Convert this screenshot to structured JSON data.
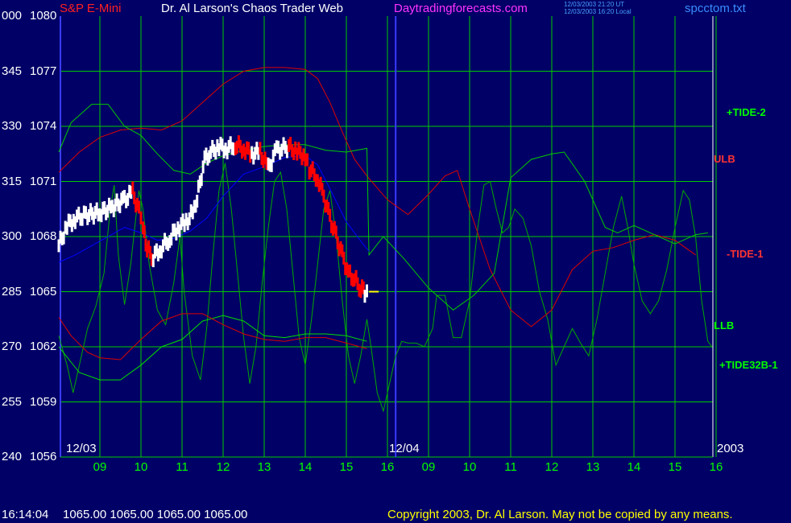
{
  "header": {
    "symbol": "S&P E-Mini",
    "title": "Dr. Al Larson's Chaos Trader Web",
    "site": "Daytradingforecasts.com",
    "ut_line": "12/03/2003 21:20 UT",
    "local_line": "12/03/2003 16:20 Local",
    "filename": "spcctom.txt"
  },
  "footer": {
    "time": "16:14:04",
    "ohlc": "1065.00 1065.00 1065.00 1065.00",
    "copyright": "Copyright 2003, Dr. Al Larson. May not be copied by any means."
  },
  "colors": {
    "background": "#000066",
    "grid": "#00cc00",
    "price_bar_up": "#ffffff",
    "price_bar_down": "#ff0000",
    "ulb": "#dd0000",
    "llb": "#00dd00",
    "tide2": "#00cc00",
    "tide1": "#dd0000",
    "tide32": "#00aa00",
    "average": "#0000ff",
    "date_divider": "#3a3aff"
  },
  "chart_data": {
    "type": "line",
    "title": "S&P E-Mini",
    "y_left_angle_labels": [
      "000",
      "345",
      "330",
      "315",
      "300",
      "285",
      "270",
      "255",
      "240"
    ],
    "y_right_price_labels": [
      "1080",
      "1077",
      "1074",
      "1071",
      "1068",
      "1065",
      "1062",
      "1059",
      "1056"
    ],
    "ylim": [
      1056,
      1080
    ],
    "grid": true,
    "x_hour_ticks": [
      "09",
      "10",
      "11",
      "12",
      "13",
      "14",
      "15",
      "16",
      "09",
      "10",
      "11",
      "12",
      "13",
      "14",
      "15",
      "16"
    ],
    "date_labels": [
      "12/03",
      "12/04",
      "2003"
    ],
    "series_labels": [
      {
        "name": "+TIDE-2",
        "color": "#00ff00"
      },
      {
        "name": "ULB",
        "color": "#ff3333"
      },
      {
        "name": "-TIDE-1",
        "color": "#ff3333"
      },
      {
        "name": "LLB",
        "color": "#00ff00"
      },
      {
        "name": "+TIDE32B-1",
        "color": "#00ff00"
      }
    ],
    "price_path": [
      [
        0.0,
        1067.5
      ],
      [
        0.2,
        1068.6
      ],
      [
        0.4,
        1069.0
      ],
      [
        0.7,
        1069.2
      ],
      [
        1.0,
        1069.3
      ],
      [
        1.3,
        1069.6
      ],
      [
        1.6,
        1070.0
      ],
      [
        1.8,
        1070.4
      ],
      [
        1.95,
        1069.4
      ],
      [
        2.05,
        1068.4
      ],
      [
        2.15,
        1067.3
      ],
      [
        2.3,
        1066.9
      ],
      [
        2.5,
        1067.4
      ],
      [
        2.7,
        1067.9
      ],
      [
        2.9,
        1068.5
      ],
      [
        3.1,
        1068.8
      ],
      [
        3.3,
        1069.4
      ],
      [
        3.4,
        1070.5
      ],
      [
        3.55,
        1072.2
      ],
      [
        3.7,
        1072.6
      ],
      [
        3.9,
        1072.9
      ],
      [
        4.1,
        1072.8
      ],
      [
        4.3,
        1073.0
      ],
      [
        4.5,
        1072.8
      ],
      [
        4.7,
        1072.5
      ],
      [
        4.9,
        1072.6
      ],
      [
        5.1,
        1071.7
      ],
      [
        5.3,
        1072.7
      ],
      [
        5.6,
        1072.9
      ],
      [
        5.8,
        1072.6
      ],
      [
        6.0,
        1072.4
      ],
      [
        6.1,
        1071.7
      ],
      [
        6.3,
        1071.2
      ],
      [
        6.45,
        1070.2
      ],
      [
        6.6,
        1069.0
      ],
      [
        6.75,
        1068.0
      ],
      [
        6.9,
        1067.0
      ],
      [
        7.05,
        1066.0
      ],
      [
        7.2,
        1065.7
      ],
      [
        7.35,
        1065.2
      ],
      [
        7.45,
        1065.0
      ],
      [
        7.55,
        1065.0
      ]
    ],
    "ulb_path": [
      [
        0.0,
        1071.5
      ],
      [
        0.5,
        1072.6
      ],
      [
        1.0,
        1073.4
      ],
      [
        1.5,
        1073.8
      ],
      [
        2.0,
        1073.9
      ],
      [
        2.5,
        1073.8
      ],
      [
        3.0,
        1074.3
      ],
      [
        3.5,
        1075.3
      ],
      [
        4.0,
        1076.3
      ],
      [
        4.5,
        1077.0
      ],
      [
        5.0,
        1077.2
      ],
      [
        5.5,
        1077.2
      ],
      [
        6.0,
        1077.1
      ],
      [
        6.3,
        1076.6
      ],
      [
        6.6,
        1075.3
      ],
      [
        6.9,
        1073.7
      ],
      [
        7.2,
        1072.2
      ],
      [
        7.5,
        1071.3
      ],
      [
        8.0,
        1070.0
      ],
      [
        8.5,
        1069.2
      ],
      [
        9.0,
        1070.3
      ],
      [
        9.4,
        1071.3
      ],
      [
        9.7,
        1071.6
      ],
      [
        10.0,
        1069.5
      ],
      [
        10.5,
        1066.2
      ],
      [
        11.0,
        1064.0
      ],
      [
        11.5,
        1063.1
      ],
      [
        12.0,
        1064.0
      ],
      [
        12.5,
        1066.2
      ],
      [
        13.0,
        1067.2
      ],
      [
        13.5,
        1067.4
      ],
      [
        14.0,
        1067.8
      ],
      [
        14.5,
        1068.1
      ],
      [
        15.0,
        1067.8
      ],
      [
        15.5,
        1067.0
      ]
    ],
    "llb_path": [
      [
        0.0,
        1062.0
      ],
      [
        0.5,
        1060.6
      ],
      [
        1.0,
        1060.2
      ],
      [
        1.5,
        1060.2
      ],
      [
        2.0,
        1061.0
      ],
      [
        2.5,
        1062.0
      ],
      [
        3.0,
        1062.4
      ],
      [
        3.5,
        1063.4
      ],
      [
        4.0,
        1063.7
      ],
      [
        4.5,
        1063.4
      ],
      [
        5.0,
        1062.6
      ],
      [
        5.5,
        1062.5
      ],
      [
        6.0,
        1062.7
      ],
      [
        6.5,
        1062.7
      ],
      [
        7.0,
        1062.6
      ],
      [
        7.5,
        1062.3
      ]
    ],
    "tide2_path": [
      [
        0.0,
        1072.6
      ],
      [
        0.3,
        1074.2
      ],
      [
        0.8,
        1075.2
      ],
      [
        1.2,
        1075.2
      ],
      [
        1.6,
        1074.0
      ],
      [
        2.0,
        1073.5
      ],
      [
        2.4,
        1072.5
      ],
      [
        2.8,
        1071.6
      ],
      [
        3.2,
        1071.4
      ],
      [
        3.6,
        1072.0
      ],
      [
        4.0,
        1072.4
      ],
      [
        4.5,
        1072.7
      ],
      [
        5.0,
        1072.9
      ],
      [
        5.5,
        1073.0
      ],
      [
        6.0,
        1073.0
      ],
      [
        6.5,
        1072.7
      ],
      [
        7.0,
        1072.6
      ],
      [
        7.5,
        1072.8
      ],
      [
        7.55,
        1067.0
      ],
      [
        7.9,
        1068.0
      ],
      [
        8.4,
        1066.8
      ],
      [
        9.0,
        1065.2
      ],
      [
        9.6,
        1064.0
      ],
      [
        10.1,
        1064.8
      ],
      [
        10.6,
        1066.0
      ],
      [
        11.0,
        1071.2
      ],
      [
        11.5,
        1072.2
      ],
      [
        12.0,
        1072.5
      ],
      [
        12.3,
        1072.6
      ],
      [
        12.8,
        1071.0
      ],
      [
        13.3,
        1068.5
      ],
      [
        13.6,
        1068.2
      ],
      [
        14.0,
        1068.6
      ],
      [
        14.5,
        1068.1
      ],
      [
        15.0,
        1067.6
      ],
      [
        15.5,
        1068.1
      ],
      [
        15.8,
        1068.2
      ]
    ],
    "tide1_path": [
      [
        0.0,
        1063.6
      ],
      [
        0.3,
        1062.6
      ],
      [
        0.7,
        1061.7
      ],
      [
        1.0,
        1061.4
      ],
      [
        1.5,
        1061.3
      ],
      [
        2.0,
        1062.4
      ],
      [
        2.5,
        1063.4
      ],
      [
        3.0,
        1063.8
      ],
      [
        3.5,
        1063.8
      ],
      [
        4.0,
        1063.2
      ],
      [
        4.5,
        1062.7
      ],
      [
        5.0,
        1062.4
      ],
      [
        5.5,
        1062.3
      ],
      [
        6.0,
        1062.5
      ],
      [
        6.5,
        1062.5
      ],
      [
        7.0,
        1062.2
      ],
      [
        7.5,
        1061.9
      ]
    ],
    "avg_path": [
      [
        0.0,
        1066.6
      ],
      [
        0.4,
        1067.0
      ],
      [
        0.8,
        1067.5
      ],
      [
        1.2,
        1068.0
      ],
      [
        1.6,
        1068.5
      ],
      [
        2.0,
        1068.2
      ],
      [
        2.4,
        1067.8
      ],
      [
        2.8,
        1067.9
      ],
      [
        3.2,
        1068.3
      ],
      [
        3.6,
        1069.0
      ],
      [
        4.0,
        1070.2
      ],
      [
        4.5,
        1071.4
      ],
      [
        5.0,
        1071.8
      ],
      [
        5.5,
        1072.3
      ],
      [
        6.0,
        1072.4
      ],
      [
        6.3,
        1071.9
      ],
      [
        6.6,
        1070.6
      ],
      [
        7.0,
        1068.8
      ],
      [
        7.4,
        1067.6
      ],
      [
        7.55,
        1067.2
      ]
    ],
    "tide32_path": [
      [
        0.0,
        1062.6
      ],
      [
        0.2,
        1061.0
      ],
      [
        0.35,
        1059.5
      ],
      [
        0.5,
        1061.0
      ],
      [
        0.7,
        1063.0
      ],
      [
        0.9,
        1064.2
      ],
      [
        1.1,
        1066.0
      ],
      [
        1.25,
        1069.5
      ],
      [
        1.35,
        1070.8
      ],
      [
        1.45,
        1067.0
      ],
      [
        1.6,
        1064.3
      ],
      [
        1.75,
        1066.5
      ],
      [
        1.85,
        1068.5
      ],
      [
        1.95,
        1070.5
      ],
      [
        2.05,
        1069.5
      ],
      [
        2.2,
        1066.5
      ],
      [
        2.4,
        1064.0
      ],
      [
        2.6,
        1063.2
      ],
      [
        2.8,
        1065.5
      ],
      [
        2.95,
        1068.0
      ],
      [
        3.05,
        1065.0
      ],
      [
        3.25,
        1061.5
      ],
      [
        3.45,
        1060.2
      ],
      [
        3.6,
        1063.0
      ],
      [
        3.75,
        1067.0
      ],
      [
        3.9,
        1070.5
      ],
      [
        4.05,
        1072.0
      ],
      [
        4.2,
        1069.5
      ],
      [
        4.35,
        1066.0
      ],
      [
        4.5,
        1062.5
      ],
      [
        4.65,
        1060.0
      ],
      [
        4.8,
        1062.0
      ],
      [
        4.95,
        1065.5
      ],
      [
        5.1,
        1068.5
      ],
      [
        5.25,
        1071.0
      ],
      [
        5.4,
        1071.5
      ],
      [
        5.55,
        1069.5
      ],
      [
        5.7,
        1066.0
      ],
      [
        5.85,
        1062.5
      ],
      [
        6.0,
        1061.0
      ],
      [
        6.15,
        1063.5
      ],
      [
        6.3,
        1066.5
      ],
      [
        6.45,
        1069.5
      ],
      [
        6.6,
        1070.5
      ],
      [
        6.75,
        1068.0
      ],
      [
        6.9,
        1064.5
      ],
      [
        7.05,
        1061.5
      ],
      [
        7.2,
        1060.0
      ],
      [
        7.35,
        1061.5
      ],
      [
        7.5,
        1063.5
      ],
      [
        7.6,
        1062.0
      ],
      [
        7.75,
        1059.5
      ],
      [
        7.9,
        1058.5
      ],
      [
        8.05,
        1060.0
      ],
      [
        8.2,
        1061.5
      ],
      [
        8.35,
        1062.3
      ],
      [
        8.5,
        1062.2
      ],
      [
        8.7,
        1062.2
      ],
      [
        8.9,
        1062.0
      ],
      [
        9.1,
        1063.0
      ],
      [
        9.2,
        1064.8
      ],
      [
        9.4,
        1064.8
      ],
      [
        9.6,
        1062.5
      ],
      [
        9.8,
        1062.5
      ],
      [
        10.0,
        1064.5
      ],
      [
        10.2,
        1068.5
      ],
      [
        10.35,
        1070.8
      ],
      [
        10.5,
        1071.0
      ],
      [
        10.65,
        1069.5
      ],
      [
        10.8,
        1068.2
      ],
      [
        10.95,
        1068.5
      ],
      [
        11.1,
        1069.5
      ],
      [
        11.3,
        1069.0
      ],
      [
        11.5,
        1067.5
      ],
      [
        11.7,
        1065.0
      ],
      [
        11.9,
        1063.5
      ],
      [
        12.1,
        1061.0
      ],
      [
        12.3,
        1062.0
      ],
      [
        12.5,
        1063.0
      ],
      [
        12.7,
        1062.2
      ],
      [
        12.9,
        1061.5
      ],
      [
        13.1,
        1063.5
      ],
      [
        13.3,
        1066.0
      ],
      [
        13.5,
        1068.5
      ],
      [
        13.7,
        1070.2
      ],
      [
        13.85,
        1068.5
      ],
      [
        14.0,
        1066.5
      ],
      [
        14.2,
        1064.5
      ],
      [
        14.4,
        1063.8
      ],
      [
        14.6,
        1064.5
      ],
      [
        14.8,
        1066.2
      ],
      [
        15.0,
        1068.5
      ],
      [
        15.2,
        1070.5
      ],
      [
        15.35,
        1070.0
      ],
      [
        15.5,
        1068.0
      ],
      [
        15.65,
        1064.5
      ],
      [
        15.8,
        1062.3
      ],
      [
        15.9,
        1062.0
      ]
    ]
  }
}
